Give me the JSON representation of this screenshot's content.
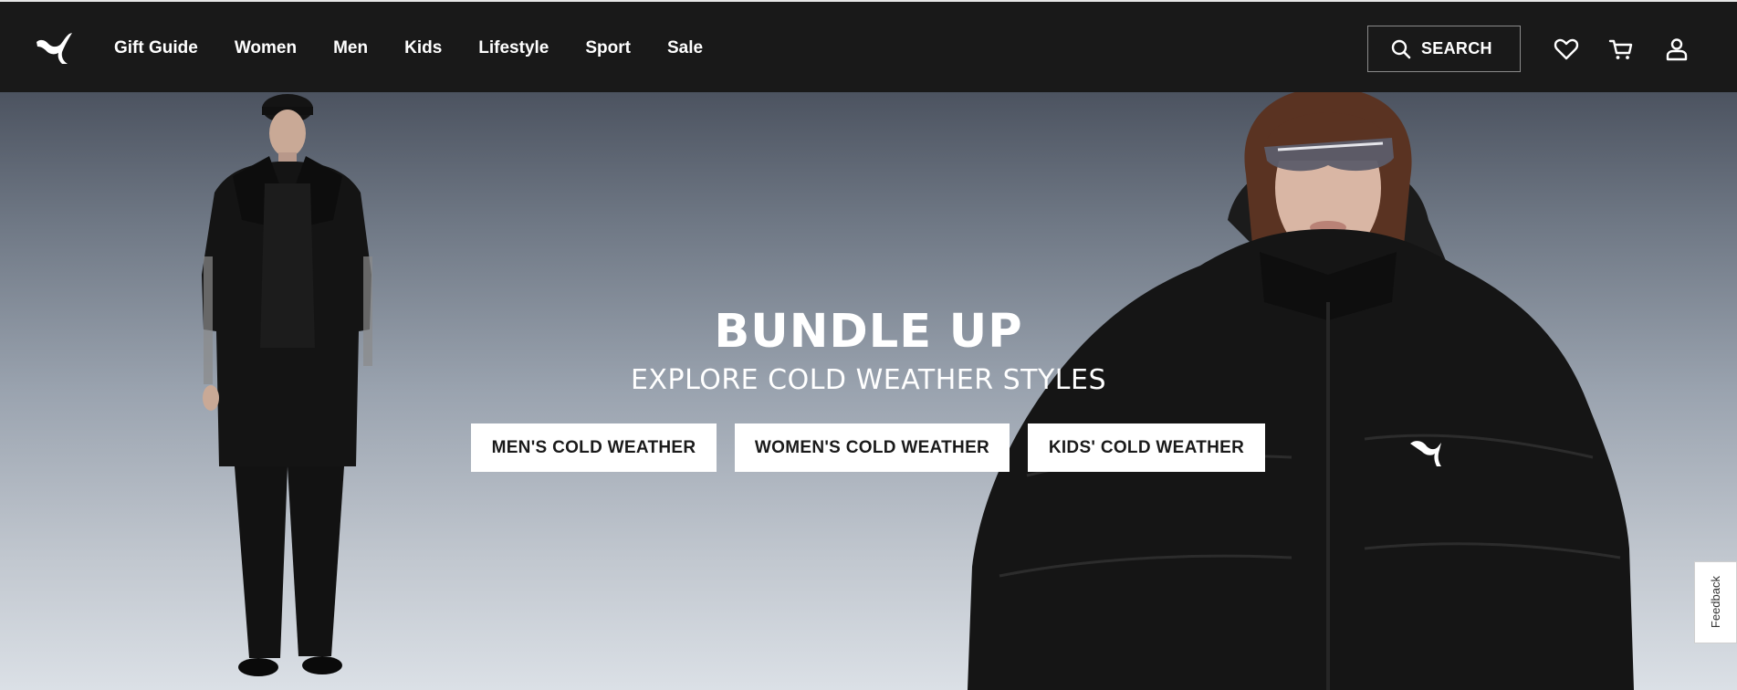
{
  "header": {
    "logo_icon": "puma-cat-logo-icon",
    "nav": [
      "Gift Guide",
      "Women",
      "Men",
      "Kids",
      "Lifestyle",
      "Sport",
      "Sale"
    ],
    "search_label": "SEARCH",
    "icons": [
      "search-icon",
      "heart-icon",
      "cart-icon",
      "account-icon"
    ]
  },
  "hero": {
    "title": "BUNDLE UP",
    "subtitle": "EXPLORE COLD WEATHER STYLES",
    "buttons": {
      "men": "MEN'S COLD WEATHER",
      "women": "WOMEN'S COLD WEATHER",
      "kids": "KIDS' COLD WEATHER"
    }
  },
  "feedback_tab": "Feedback",
  "colors": {
    "header_bg": "#191919",
    "hero_top": "#4c5360",
    "hero_bottom": "#dbe0e6",
    "button_bg": "#ffffff",
    "text_dark": "#1a1a1a"
  }
}
